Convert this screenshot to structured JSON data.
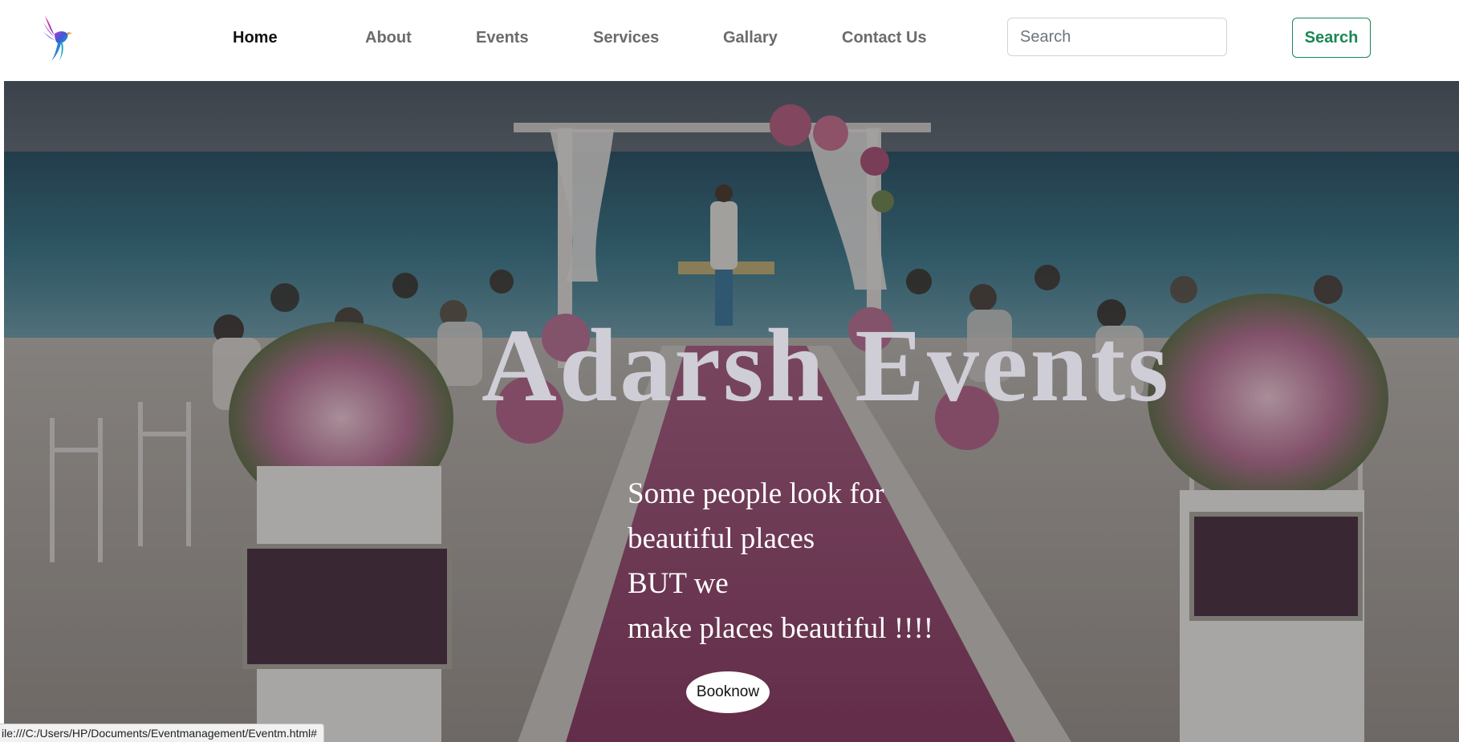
{
  "nav": {
    "logo": "bird-logo",
    "links": [
      "Home",
      "About",
      "Events",
      "Services",
      "Gallary",
      "Contact Us"
    ],
    "active": "Home",
    "search_placeholder": "Search",
    "search_button": "Search"
  },
  "hero": {
    "title": "Adarsh Events",
    "tagline": [
      "Some people look for",
      "beautiful places",
      "BUT we",
      "make places beautiful !!!!"
    ],
    "book_button": "Booknow",
    "background": "beach wedding ceremony with flower aisle"
  },
  "status_bar": {
    "url": "ile:///C:/Users/HP/Documents/Eventmanagement/Eventm.html#"
  },
  "colors": {
    "search_accent": "#198754",
    "nav_text": "#6b6b6b",
    "nav_active": "#111111",
    "title_color": "#cfcdd6"
  }
}
